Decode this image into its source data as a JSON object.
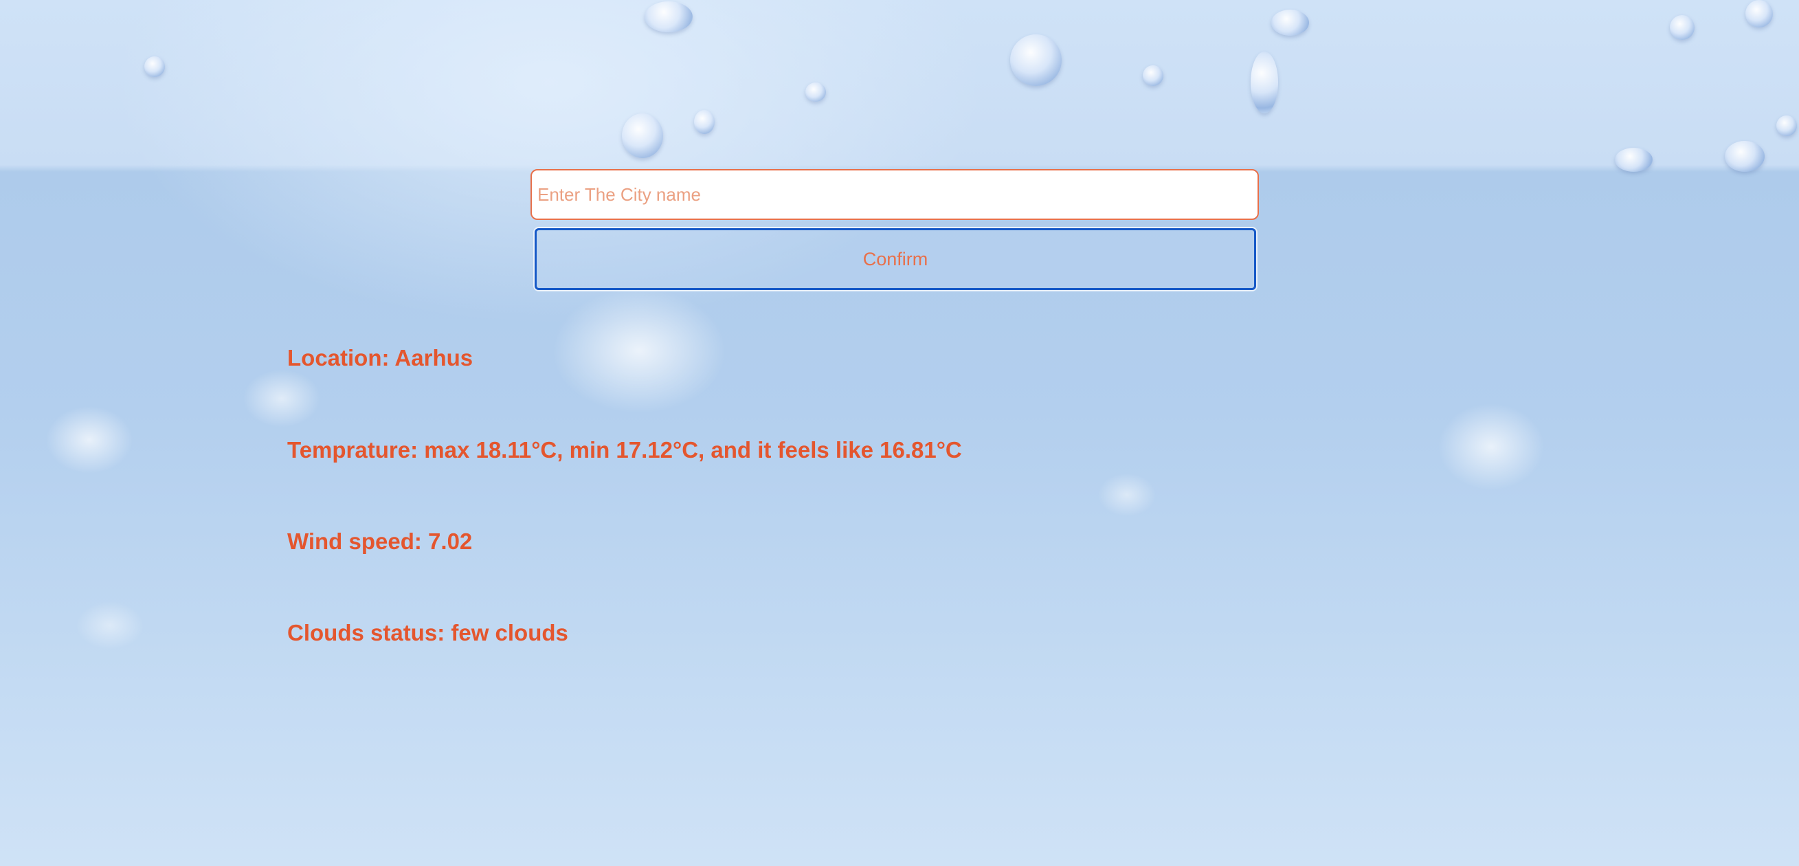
{
  "search": {
    "placeholder": "Enter The City name",
    "value": ""
  },
  "confirm_button": {
    "label": "Confirm"
  },
  "weather": {
    "location": "Location: Aarhus",
    "temperature": "Temprature: max 18.11°C, min 17.12°C, and it feels like 16.81°C",
    "wind_speed": "Wind speed: 7.02",
    "clouds": "Clouds status: few clouds"
  },
  "colors": {
    "accent_text": "#e4562e",
    "input_border": "#e8704a",
    "button_border": "#1659c7"
  }
}
